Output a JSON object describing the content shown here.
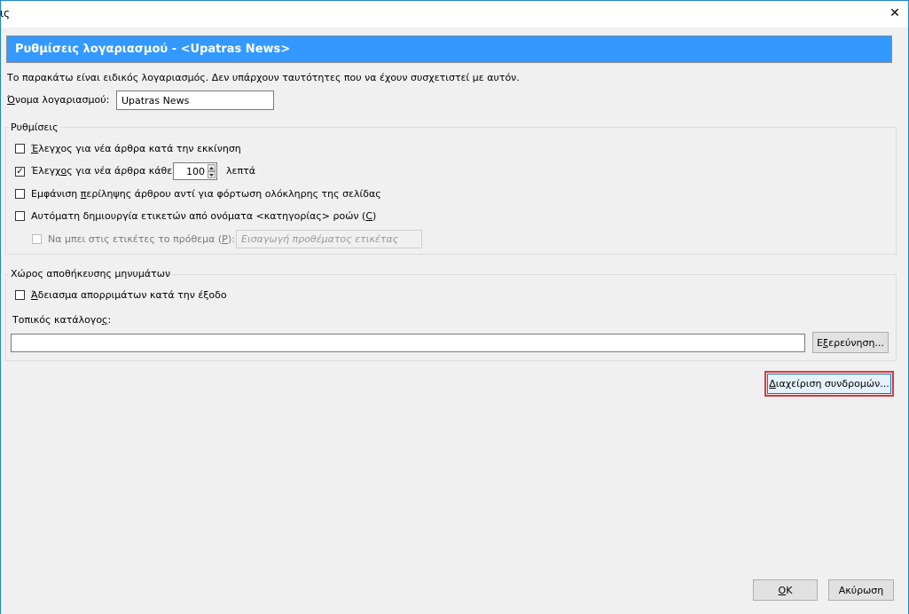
{
  "window": {
    "title": "ις",
    "close_glyph": "✕"
  },
  "header": {
    "title": "Ρυθμίσεις λογαριασμού - <Upatras News>"
  },
  "description": "Το παρακάτω είναι ειδικός λογαριασμός. Δεν υπάρχουν ταυτότητες που να έχουν συσχετιστεί με αυτόν.",
  "account": {
    "name_label_pre": "Ό",
    "name_label_post": "νομα λογαριασμού:",
    "name_value": "Upatras News"
  },
  "settings": {
    "title": "Ρυθμίσεις",
    "check_startup": {
      "label_pre": "Έ",
      "label_post": "λεγχος για νέα άρθρα κατά την εκκίνηση",
      "checked": false
    },
    "check_every": {
      "label_pre": "Έλεγχ",
      "label_u": "ο",
      "label_post": "ς για νέα άρθρα κάθε",
      "checked": true,
      "value": "100",
      "unit": "λεπτά"
    },
    "show_summary": {
      "label_pre": "Εμφάνιση ",
      "label_u": "π",
      "label_post": "ερίληψης άρθρου αντί για φόρτωση ολόκληρης της σελίδας",
      "checked": false
    },
    "auto_tags": {
      "label_pre": "Αυτόματη δημιουργία ετικετών από ονόματα <κατηγορίας> ροών (",
      "label_u": "C",
      "label_post": ")",
      "checked": false
    },
    "tag_prefix": {
      "label_pre": "Να μπει στις ετικέτες το πρόθεμα (",
      "label_u": "P",
      "label_post": "):",
      "checked": false,
      "placeholder": "Εισαγωγή προθέματος ετικέτας"
    }
  },
  "storage": {
    "title": "Χώρος αποθήκευσης μηνυμάτων",
    "empty_trash": {
      "label_pre": "Ά",
      "label_post": "δειασμα απορριμάτων κατά την έξοδο",
      "checked": false
    },
    "local_dir_label_pre": "Τοπικός κατάλογο",
    "local_dir_label_u": "ς",
    "local_dir_label_post": ":",
    "local_dir_value": "",
    "browse_pre": "Ε",
    "browse_u": "ξ",
    "browse_post": "ερεύνηση..."
  },
  "manage_subs": {
    "label_u": "Δ",
    "label_post": "ιαχείριση συνδρομών..."
  },
  "footer": {
    "ok_u": "O",
    "ok_post": "K",
    "cancel": "Ακύρωση"
  },
  "check_glyph": "✓",
  "colors": {
    "header_bg": "#3399ff",
    "frame": "#1e88c6",
    "focus": "#d9363e"
  }
}
